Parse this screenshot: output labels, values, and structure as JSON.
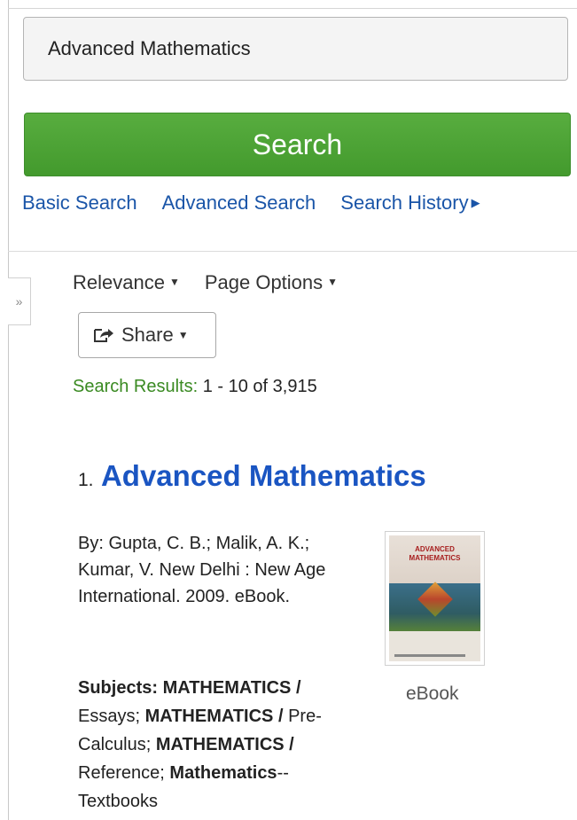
{
  "search": {
    "query": "Advanced Mathematics",
    "button_label": "Search",
    "links": {
      "basic": "Basic Search",
      "advanced": "Advanced Search",
      "history": "Search History"
    }
  },
  "results_toolbar": {
    "toggle_glyph": "»",
    "sort_label": "Relevance",
    "page_options_label": "Page Options",
    "share_label": "Share",
    "results_label": "Search Results:",
    "results_range": "1 - 10 of 3,915"
  },
  "results": [
    {
      "number": "1.",
      "title": "Advanced Mathematics",
      "byline": "By: Gupta, C. B.; Malik, A. K.; Kumar, V. New Delhi : New Age International. 2009. eBook.",
      "subjects_label": "Subjects:",
      "subjects": [
        {
          "main": "MATHEMATICS /",
          "sub": "Essays;"
        },
        {
          "main": "MATHEMATICS /",
          "sub": "Pre-Calculus;"
        },
        {
          "main": "MATHEMATICS /",
          "sub": "Reference;"
        },
        {
          "main": "Mathematics",
          "sub": "--Textbooks"
        }
      ],
      "cover_text": {
        "line1": "ADVANCED",
        "line2": "MATHEMATICS"
      },
      "format": "eBook"
    }
  ],
  "icons": {
    "share": "share-icon",
    "caret": "caret-down-icon",
    "history_caret": "caret-right-icon",
    "toggle": "expand-sidebar-icon"
  },
  "colors": {
    "search_button": "#4ea336",
    "link_blue": "#1a55a8",
    "title_blue": "#1a55c2",
    "results_label_green": "#3a8a22"
  }
}
